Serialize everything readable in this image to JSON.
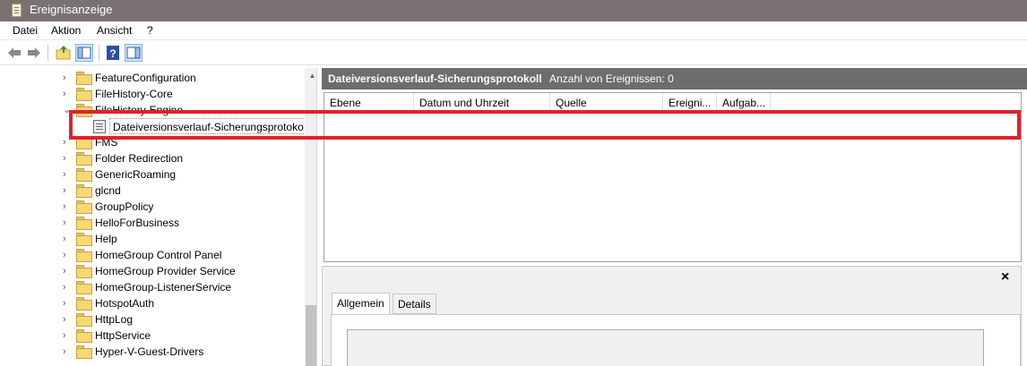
{
  "window": {
    "title": "Ereignisanzeige",
    "icon": "event-viewer-icon"
  },
  "menu": [
    "Datei",
    "Aktion",
    "Ansicht",
    "?"
  ],
  "toolbar": {
    "buttons": [
      "back-arrow-icon",
      "forward-arrow-icon",
      "up-folder-icon",
      "show-hide-tree-icon",
      "help-icon",
      "show-hide-action-pane-icon"
    ]
  },
  "tree": {
    "items": [
      "FeatureConfiguration",
      "FileHistory-Core",
      "FMS",
      "Folder Redirection",
      "GenericRoaming",
      "glcnd",
      "GroupPolicy",
      "HelloForBusiness",
      "Help",
      "HomeGroup Control Panel",
      "HomeGroup Provider Service",
      "HomeGroup-ListenerService",
      "HotspotAuth",
      "HttpLog",
      "HttpService",
      "Hyper-V-Guest-Drivers"
    ],
    "partial_parent": "FileHistory-Engine",
    "selected": "Dateiversionsverlauf-Sicherungsprotoko"
  },
  "log_header": {
    "title": "Dateiversionsverlauf-Sicherungsprotokoll",
    "count": "Anzahl von Ereignissen: 0"
  },
  "grid": {
    "columns": [
      "Ebene",
      "Datum und Uhrzeit",
      "Quelle",
      "Ereigni...",
      "Aufgab..."
    ]
  },
  "details": {
    "close": "×",
    "tabs": [
      "Allgemein",
      "Details"
    ]
  },
  "colors": {
    "titlebar": "#7a7272",
    "header": "#6d6d6d",
    "highlight": "#e0212a"
  }
}
